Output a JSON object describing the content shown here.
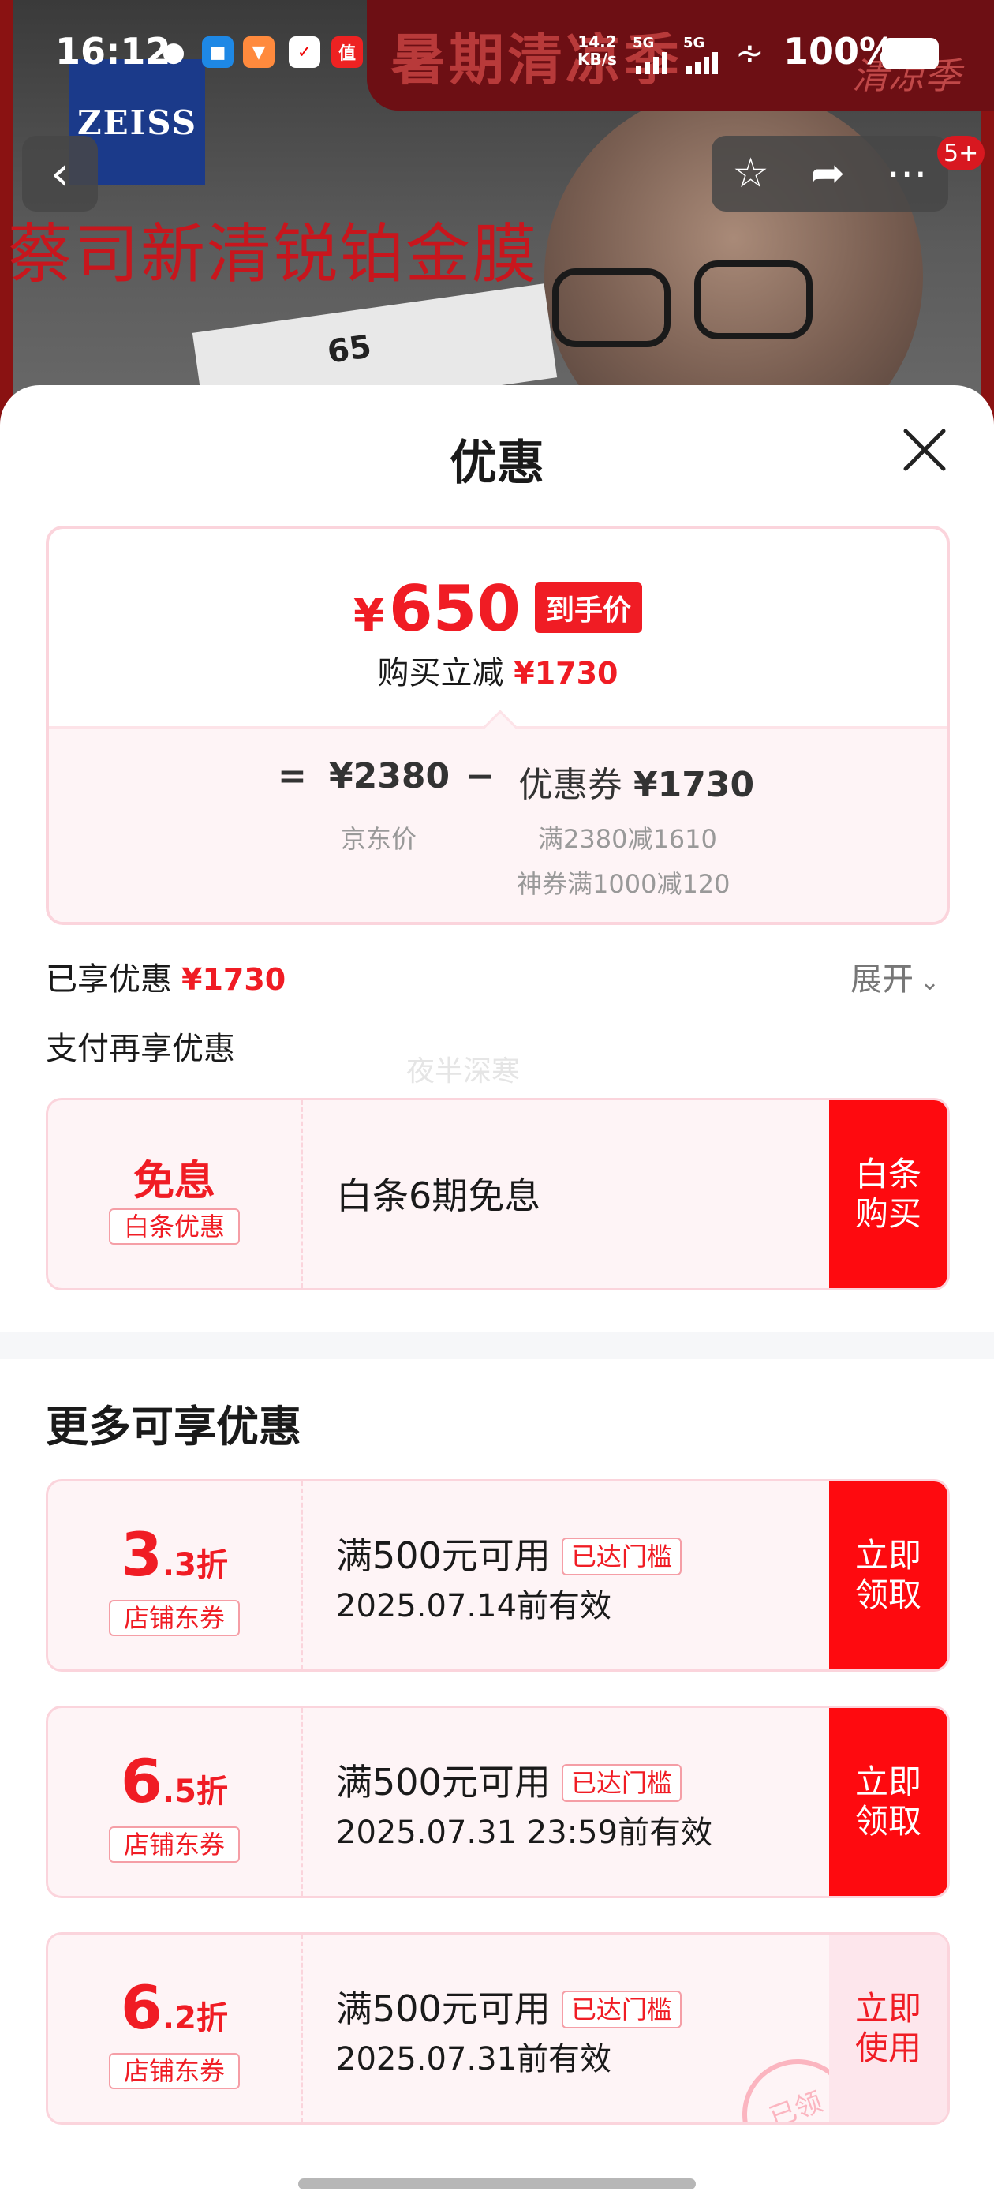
{
  "status_bar": {
    "time": "16:12",
    "speed_value": "14.2",
    "speed_unit": "KB/s",
    "signal1": "5G",
    "signal2": "5G",
    "battery": "100%",
    "app_icons": [
      "wechat-icon",
      "app-icon-blue",
      "app-icon-orange",
      "app-icon-red",
      "zhidemai-icon"
    ]
  },
  "hero": {
    "banner_text": "暑期清凉季",
    "banner_sub": "清凉季",
    "brand_logo": "ZEISS",
    "product_title": "蔡司新清锐铂金膜",
    "card_number": "65",
    "notification_badge": "5+"
  },
  "sheet": {
    "title": "优惠",
    "summary": {
      "currency": "¥",
      "final_price": "650",
      "final_tag": "到手价",
      "discount_label": "购买立减",
      "discount_value": "¥1730",
      "eq_sign": "=",
      "base_price": "¥2380",
      "minus_sign": "−",
      "coupon_label": "优惠券",
      "coupon_value": "¥1730",
      "base_price_label": "京东价",
      "coupon_detail_1": "满2380减1610",
      "coupon_detail_2": "神券满1000减120"
    },
    "enjoyed_label": "已享优惠",
    "enjoyed_value": "¥1730",
    "expand_label": "展开",
    "pay_more_label": "支付再享优惠",
    "watermark": "夜半深寒",
    "baitiao": {
      "big_text": "免息",
      "chip": "白条优惠",
      "title": "白条6期免息",
      "action": "白条 购买"
    },
    "more_title": "更多可享优惠",
    "coupons": [
      {
        "discount_main": "3",
        "discount_frac": ".3折",
        "chip": "店铺东券",
        "title": "满500元可用",
        "badge": "已达门槛",
        "date": "2025.07.14前有效",
        "action": "立即 领取"
      },
      {
        "discount_main": "6",
        "discount_frac": ".5折",
        "chip": "店铺东券",
        "title": "满500元可用",
        "badge": "已达门槛",
        "date": "2025.07.31 23:59前有效",
        "action": "立即 领取"
      },
      {
        "discount_main": "6",
        "discount_frac": ".2折",
        "chip": "店铺东券",
        "title": "满500元可用",
        "badge": "已达门槛",
        "date": "2025.07.31前有效",
        "action": "立即 使用",
        "stamp": "已领"
      }
    ]
  },
  "colors": {
    "accent": "#f01c24",
    "action_bg": "#fe0a0f",
    "card_border": "#fbd4dc",
    "card_bg": "#fef4f6"
  }
}
